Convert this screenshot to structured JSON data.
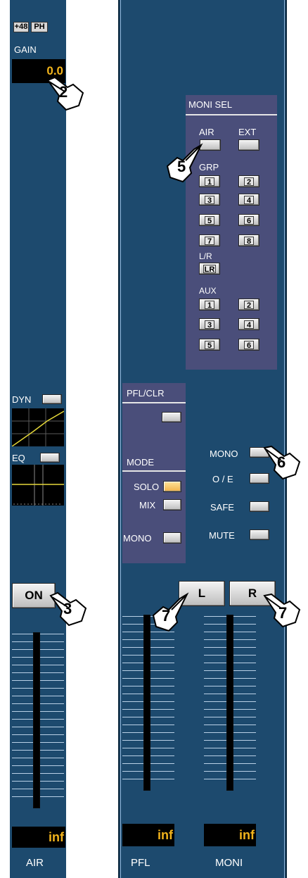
{
  "left_channel": {
    "phantom_label": "+48",
    "phase_label": "PH",
    "gain_label": "GAIN",
    "gain_value": "0.0",
    "dyn_label": "DYN",
    "eq_label": "EQ",
    "on_label": "ON",
    "level_value": "inf",
    "channel_name": "AIR"
  },
  "moni_sel": {
    "title": "MONI SEL",
    "air_label": "AIR",
    "ext_label": "EXT",
    "grp_label": "GRP",
    "grp_buttons": [
      "1",
      "2",
      "3",
      "4",
      "5",
      "6",
      "7",
      "8"
    ],
    "lr_label": "L/R",
    "lr_button": "LR",
    "aux_label": "AUX",
    "aux_buttons": [
      "1",
      "2",
      "3",
      "4",
      "5",
      "6"
    ]
  },
  "pfl": {
    "pfl_clr_label": "PFL/CLR",
    "mode_label": "MODE",
    "solo_label": "SOLO",
    "mix_label": "MIX",
    "mono_label": "MONO",
    "level_value": "inf",
    "name": "PFL",
    "l_label": "L"
  },
  "moni": {
    "mono_label": "MONO",
    "oe_label": "O / E",
    "safe_label": "SAFE",
    "mute_label": "MUTE",
    "r_label": "R",
    "level_value": "inf",
    "name": "MONI"
  },
  "callouts": {
    "c2": "2",
    "c3": "3",
    "c5": "5",
    "c6": "6",
    "c7a": "7",
    "c7b": "7"
  },
  "colors": {
    "strip_bg": "#1d4a6e",
    "panel_bg": "#4a4e7a",
    "display_text": "#f2b41c",
    "solo_lit": "#f0b24a"
  }
}
